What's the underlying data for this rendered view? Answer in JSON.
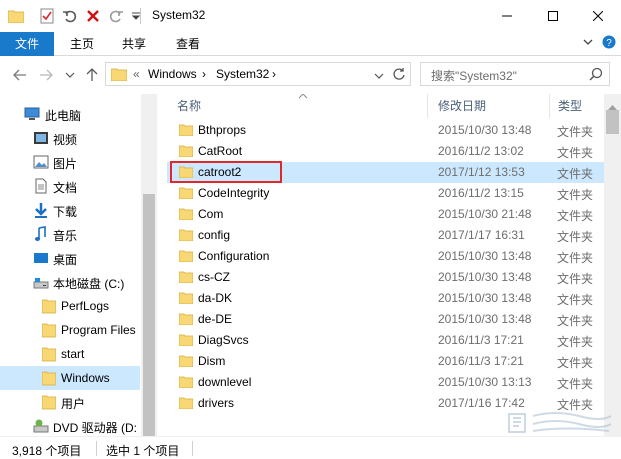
{
  "window": {
    "title": "System32",
    "controls": [
      "minimize-icon",
      "maximize-icon",
      "close-icon"
    ]
  },
  "ribbon": {
    "tabs": [
      {
        "label": "文件"
      },
      {
        "label": "主页"
      },
      {
        "label": "共享"
      },
      {
        "label": "查看"
      }
    ]
  },
  "address": {
    "overflow": "«",
    "crumbs": [
      "Windows",
      "System32"
    ]
  },
  "search": {
    "placeholder": "搜索\"System32\""
  },
  "sidebar": {
    "items": [
      {
        "label": "此电脑",
        "icon": "computer-icon"
      },
      {
        "label": "视频",
        "icon": "video-icon"
      },
      {
        "label": "图片",
        "icon": "picture-icon"
      },
      {
        "label": "文档",
        "icon": "document-icon"
      },
      {
        "label": "下载",
        "icon": "download-icon"
      },
      {
        "label": "音乐",
        "icon": "music-icon"
      },
      {
        "label": "桌面",
        "icon": "desktop-icon"
      },
      {
        "label": "本地磁盘 (C:)",
        "icon": "drive-icon"
      },
      {
        "label": "PerfLogs",
        "icon": "folder-icon"
      },
      {
        "label": "Program Files",
        "icon": "folder-icon"
      },
      {
        "label": "start",
        "icon": "folder-icon"
      },
      {
        "label": "Windows",
        "icon": "folder-icon",
        "selected": true
      },
      {
        "label": "用户",
        "icon": "folder-icon"
      },
      {
        "label": "DVD 驱动器 (D:",
        "icon": "dvd-drive-icon"
      }
    ]
  },
  "columns": {
    "name": "名称",
    "date": "修改日期",
    "type": "类型"
  },
  "files": [
    {
      "name": "Bthprops",
      "date": "2015/10/30 13:48",
      "type": "文件夹"
    },
    {
      "name": "CatRoot",
      "date": "2016/11/2 13:02",
      "type": "文件夹"
    },
    {
      "name": "catroot2",
      "date": "2017/1/12 13:53",
      "type": "文件夹",
      "selected": true
    },
    {
      "name": "CodeIntegrity",
      "date": "2016/11/2 13:15",
      "type": "文件夹"
    },
    {
      "name": "Com",
      "date": "2015/10/30 21:48",
      "type": "文件夹"
    },
    {
      "name": "config",
      "date": "2017/1/17 16:31",
      "type": "文件夹"
    },
    {
      "name": "Configuration",
      "date": "2015/10/30 13:48",
      "type": "文件夹"
    },
    {
      "name": "cs-CZ",
      "date": "2015/10/30 13:48",
      "type": "文件夹"
    },
    {
      "name": "da-DK",
      "date": "2015/10/30 13:48",
      "type": "文件夹"
    },
    {
      "name": "de-DE",
      "date": "2015/10/30 13:48",
      "type": "文件夹"
    },
    {
      "name": "DiagSvcs",
      "date": "2016/11/3 17:21",
      "type": "文件夹"
    },
    {
      "name": "Dism",
      "date": "2016/11/3 17:21",
      "type": "文件夹"
    },
    {
      "name": "downlevel",
      "date": "2015/10/30 13:13",
      "type": "文件夹"
    },
    {
      "name": "drivers",
      "date": "2017/1/16 17:42",
      "type": "文件夹"
    }
  ],
  "status": {
    "count": "3,918 个项目",
    "selection": "选中 1 个项目"
  },
  "colors": {
    "accent": "#1979ca",
    "selection": "#cce8ff",
    "highlight_border": "#e0272c",
    "folder": "#f8d775"
  }
}
